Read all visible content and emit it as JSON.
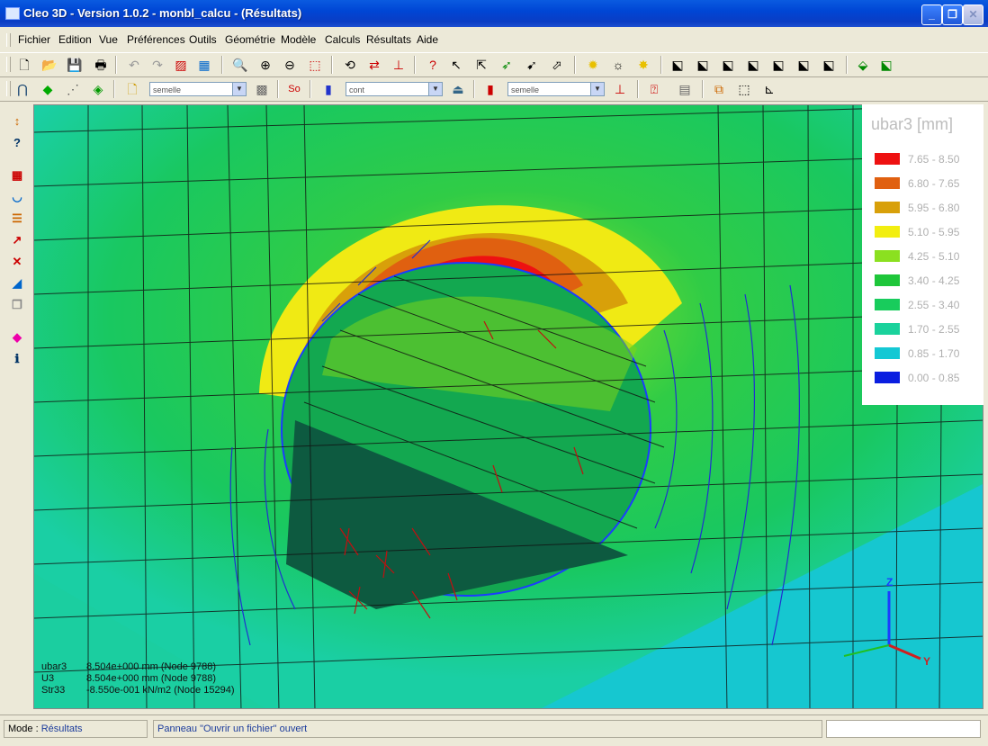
{
  "window": {
    "title": "Cleo 3D - Version 1.0.2 - monbl_calcu - (Résultats)"
  },
  "menu": [
    "Fichier",
    "Edition",
    "Vue",
    "Préférences",
    "Outils",
    "Géométrie",
    "Modèle",
    "Calculs",
    "Résultats",
    "Aide"
  ],
  "toolbar2": {
    "combo1": "semelle",
    "combo2": "cont",
    "combo3": "semelle",
    "so_label": "So"
  },
  "legend": {
    "title": "ubar3 [mm]",
    "entries": [
      {
        "label": "7.65 - 8.50",
        "color": "#ee1111"
      },
      {
        "label": "6.80 - 7.65",
        "color": "#e06010"
      },
      {
        "label": "5.95 - 6.80",
        "color": "#d8a00a"
      },
      {
        "label": "5.10 - 5.95",
        "color": "#f2ee10"
      },
      {
        "label": "4.25 - 5.10",
        "color": "#8be020"
      },
      {
        "label": "3.40 - 4.25",
        "color": "#1ec63a"
      },
      {
        "label": "2.55 - 3.40",
        "color": "#18cc5c"
      },
      {
        "label": "1.70 - 2.55",
        "color": "#1ad29c"
      },
      {
        "label": "0.85 - 1.70",
        "color": "#14c8d4"
      },
      {
        "label": "0.00 - 0.85",
        "color": "#0a1ee0"
      }
    ]
  },
  "readout": [
    {
      "key": "ubar3",
      "value": "8.504e+000 mm (Node 9788)"
    },
    {
      "key": "U3",
      "value": "8.504e+000 mm (Node 9788)"
    },
    {
      "key": "Str33",
      "value": "-8.550e-001 kN/m2 (Node 15294)"
    }
  ],
  "axes": {
    "z": "Z",
    "y": "Y"
  },
  "status": {
    "mode_label": "Mode :",
    "mode_value": "Résultats",
    "message": "Panneau \"Ouvrir un fichier\" ouvert",
    "extra": ""
  }
}
